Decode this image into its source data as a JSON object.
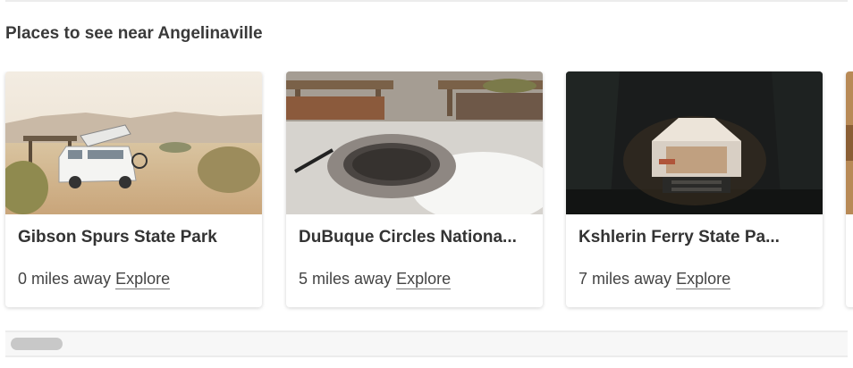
{
  "section": {
    "title": "Places to see near Angelinaville"
  },
  "cards": [
    {
      "title": "Gibson Spurs State Park",
      "distance": "0 miles away",
      "link": "Explore",
      "image": "desert-van-photo"
    },
    {
      "title": "DuBuque Circles Nationa...",
      "distance": "5 miles away",
      "link": "Explore",
      "image": "firepit-benches-photo"
    },
    {
      "title": "Kshlerin Ferry State Pa...",
      "distance": "7 miles away",
      "link": "Explore",
      "image": "night-tent-photo"
    }
  ],
  "colors": {
    "text": "#333333",
    "divider": "#ececec",
    "scroll_thumb": "#c8c8c8"
  }
}
